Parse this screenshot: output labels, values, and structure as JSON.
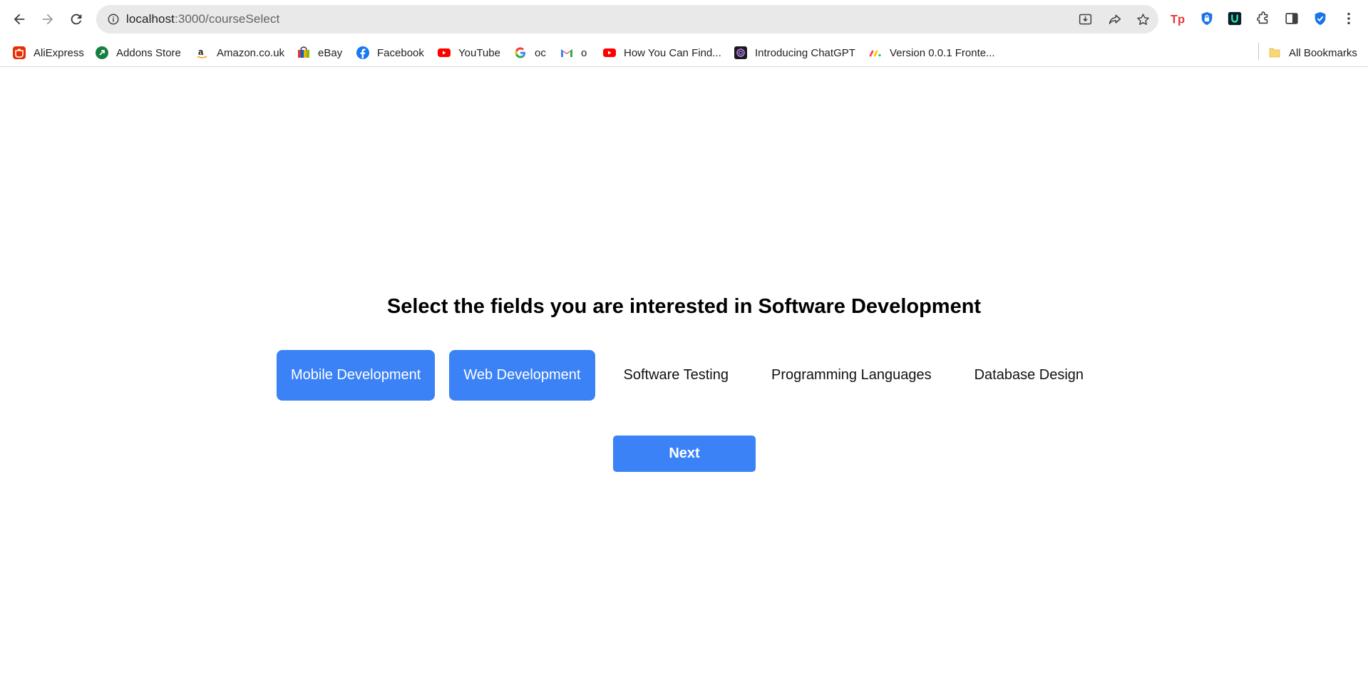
{
  "browser": {
    "url_host": "localhost",
    "url_path": ":3000/courseSelect",
    "bookmarks": [
      {
        "label": "AliExpress",
        "icon": "aliexpress-icon"
      },
      {
        "label": "Addons Store",
        "icon": "addons-store-icon"
      },
      {
        "label": "Amazon.co.uk",
        "icon": "amazon-icon"
      },
      {
        "label": "eBay",
        "icon": "ebay-icon"
      },
      {
        "label": "Facebook",
        "icon": "facebook-icon"
      },
      {
        "label": "YouTube",
        "icon": "youtube-icon"
      },
      {
        "label": "oc",
        "icon": "google-icon"
      },
      {
        "label": "o",
        "icon": "gmail-icon"
      },
      {
        "label": "How You Can Find...",
        "icon": "youtube-icon"
      },
      {
        "label": "Introducing ChatGPT",
        "icon": "chatgpt-icon"
      },
      {
        "label": "Version 0.0.1 Fronte...",
        "icon": "monday-icon"
      }
    ],
    "all_bookmarks_label": "All Bookmarks"
  },
  "page": {
    "heading": "Select the fields you are interested in Software Development",
    "options": [
      {
        "label": "Mobile Development",
        "selected": true
      },
      {
        "label": "Web Development",
        "selected": true
      },
      {
        "label": "Software Testing",
        "selected": false
      },
      {
        "label": "Programming Languages",
        "selected": false
      },
      {
        "label": "Database Design",
        "selected": false
      }
    ],
    "next_label": "Next"
  },
  "colors": {
    "accent": "#3b82f6",
    "omnibox_bg": "#e9e9e9"
  }
}
